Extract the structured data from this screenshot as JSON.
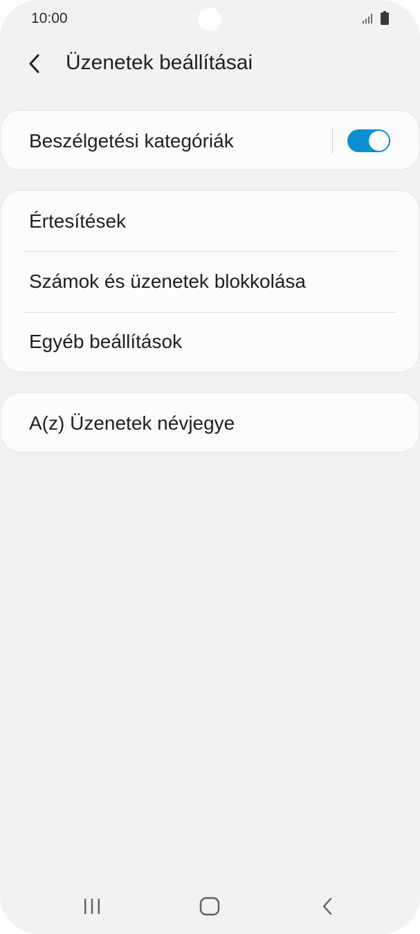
{
  "status_bar": {
    "time": "10:00",
    "icons": [
      "signal-icon",
      "battery-icon"
    ]
  },
  "header": {
    "back_icon": "back-arrow-icon",
    "title": "Üzenetek beállításai"
  },
  "settings": {
    "conversation_categories": {
      "label": "Beszélgetési kategóriák",
      "toggle_on": true
    },
    "group": [
      {
        "label": "Értesítések"
      },
      {
        "label": "Számok és üzenetek blokkolása"
      },
      {
        "label": "Egyéb beállítások"
      }
    ],
    "about": {
      "label": "A(z) Üzenetek névjegye"
    }
  },
  "nav_bar": {
    "icons": [
      "recent-apps-icon",
      "home-icon",
      "back-icon"
    ]
  },
  "colors": {
    "accent": "#0a8fd2",
    "background": "#f2f2f2",
    "card": "#fcfcfc"
  }
}
